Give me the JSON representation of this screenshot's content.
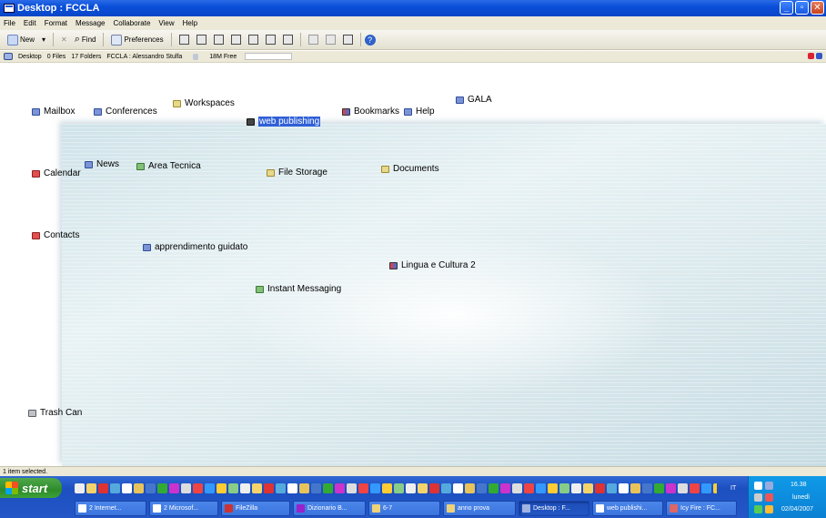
{
  "window": {
    "title": "Desktop : FCCLA"
  },
  "menu": [
    "File",
    "Edit",
    "Format",
    "Message",
    "Collaborate",
    "View",
    "Help"
  ],
  "toolbar": {
    "new_label": "New",
    "find_label": "Find",
    "preferences_label": "Preferences"
  },
  "pathbar": {
    "location": "Desktop",
    "files": "0 Files",
    "folders": "17 Folders",
    "user": "FCCLA : Alessandro Stulfa",
    "free": "18M Free"
  },
  "desktop_items": {
    "mailbox": "Mailbox",
    "conferences": "Conferences",
    "workspaces": "Workspaces",
    "web_publishing": "web publishing",
    "bookmarks": "Bookmarks",
    "help": "Help",
    "gala": "GALA",
    "calendar": "Calendar",
    "news": "News",
    "area_tecnica": "Area Tecnica",
    "file_storage": "File Storage",
    "documents": "Documents",
    "contacts": "Contacts",
    "apprendimento": "apprendimento guidato",
    "lingua": "Lingua e Cultura 2",
    "instant_messaging": "Instant Messaging",
    "trash": "Trash Can"
  },
  "status": {
    "text": "1 item selected."
  },
  "taskbar": {
    "start_label": "start",
    "tasks": [
      "2 Internet...",
      "2 Microsof...",
      "FileZilla",
      "Dizionario B...",
      "6-7",
      "anno prova",
      "Desktop : F...",
      "web publishi...",
      "Icy Fire : FC..."
    ],
    "language": "IT",
    "time": "16.38",
    "day": "lunedì",
    "date": "02/04/2007"
  },
  "colors": {
    "titlebar": "#0a4fd8",
    "selection": "#2f5fd7",
    "taskbar": "#2456c8",
    "start": "#2e8b2a",
    "tray": "#0c80d3"
  }
}
